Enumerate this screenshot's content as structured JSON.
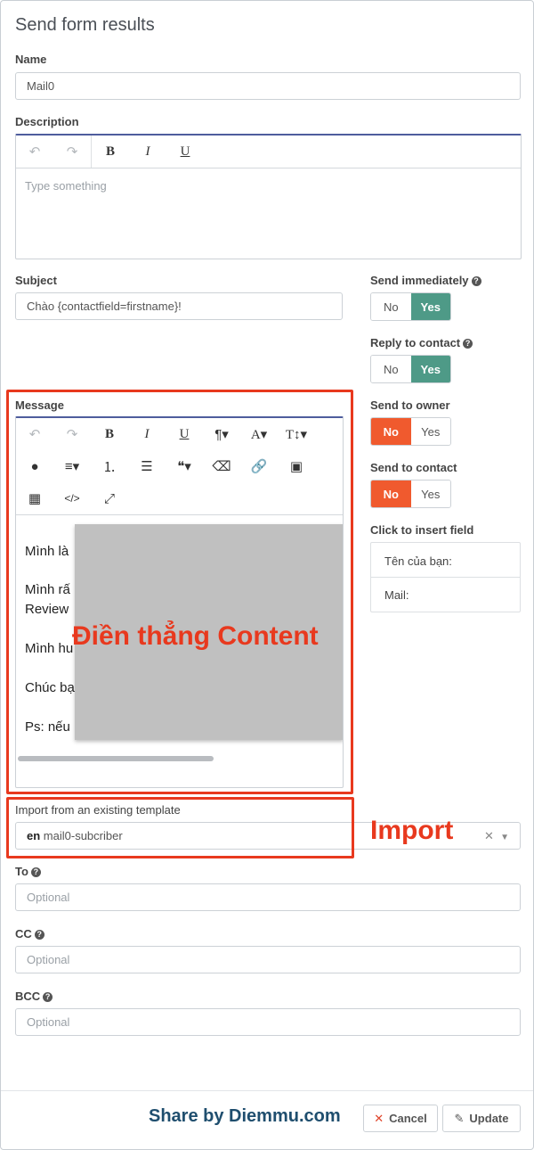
{
  "modal": {
    "title": "Send form results",
    "name": {
      "label": "Name",
      "value": "Mail0"
    },
    "description": {
      "label": "Description",
      "placeholder": "Type something",
      "toolbar": [
        "undo-icon",
        "redo-icon",
        "bold-icon",
        "italic-icon",
        "underline-icon"
      ],
      "bold_label": "B",
      "italic_label": "I",
      "underline_label": "U"
    },
    "subject": {
      "label": "Subject",
      "value": "Chào {contactfield=firstname}!"
    },
    "send_immediately": {
      "label": "Send immediately",
      "no": "No",
      "yes": "Yes",
      "selected": "Yes"
    },
    "reply_to_contact": {
      "label": "Reply to contact",
      "no": "No",
      "yes": "Yes",
      "selected": "Yes"
    },
    "send_to_owner": {
      "label": "Send to owner",
      "no": "No",
      "yes": "Yes",
      "selected": "No"
    },
    "send_to_contact": {
      "label": "Send to contact",
      "no": "No",
      "yes": "Yes",
      "selected": "No"
    },
    "insert_field": {
      "label": "Click to insert field",
      "items": [
        "Tên của bạn:",
        "Mail:"
      ]
    },
    "message": {
      "label": "Message",
      "lines": [
        "Mình là",
        "Mình rấ",
        "Review",
        "Mình hu",
        "Chúc bạ",
        "Ps: nếu"
      ]
    },
    "template": {
      "label": "Import from an existing template",
      "lang": "en",
      "value": "mail0-subcriber"
    },
    "to": {
      "label": "To",
      "placeholder": "Optional"
    },
    "cc": {
      "label": "CC",
      "placeholder": "Optional"
    },
    "bcc": {
      "label": "BCC",
      "placeholder": "Optional"
    },
    "footer": {
      "cancel": "Cancel",
      "update": "Update"
    }
  },
  "annotations": {
    "content": "Điền thẳng Content",
    "import": "Import",
    "watermark": "Share by Diemmu.com"
  },
  "colors": {
    "accent_green": "#4e9a87",
    "accent_red": "#f05a2e",
    "annotation_red": "#e8391e",
    "watermark_blue": "#1f4e6e"
  }
}
